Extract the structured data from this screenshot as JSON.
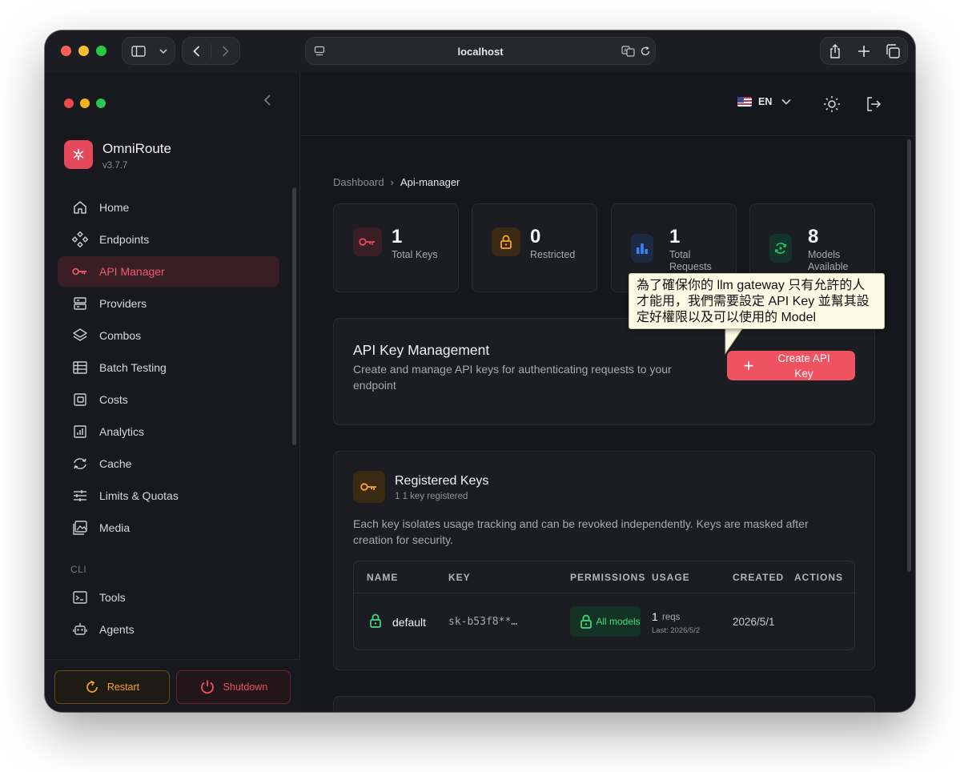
{
  "browser": {
    "url": "localhost"
  },
  "app": {
    "name": "OmniRoute",
    "version": "v3.7.7"
  },
  "sidebar": {
    "items": [
      {
        "label": "Home",
        "icon": "home-icon"
      },
      {
        "label": "Endpoints",
        "icon": "endpoints-icon"
      },
      {
        "label": "API Manager",
        "icon": "key-icon",
        "active": true
      },
      {
        "label": "Providers",
        "icon": "server-icon"
      },
      {
        "label": "Combos",
        "icon": "layers-icon"
      },
      {
        "label": "Batch Testing",
        "icon": "table-icon"
      },
      {
        "label": "Costs",
        "icon": "wallet-icon"
      },
      {
        "label": "Analytics",
        "icon": "chart-icon"
      },
      {
        "label": "Cache",
        "icon": "refresh-icon"
      },
      {
        "label": "Limits & Quotas",
        "icon": "sliders-icon"
      },
      {
        "label": "Media",
        "icon": "media-icon"
      }
    ],
    "section_cli": "CLI",
    "cli_items": [
      {
        "label": "Tools",
        "icon": "terminal-icon"
      },
      {
        "label": "Agents",
        "icon": "robot-icon"
      }
    ],
    "restart_label": "Restart",
    "shutdown_label": "Shutdown"
  },
  "header": {
    "language": "EN"
  },
  "breadcrumb": {
    "root": "Dashboard",
    "separator": "›",
    "current": "Api-manager"
  },
  "stats": [
    {
      "value": "1",
      "label": "Total Keys",
      "icon": "key-icon",
      "color": "#e5485a"
    },
    {
      "value": "0",
      "label": "Restricted",
      "icon": "lock-icon",
      "color": "#f5a524"
    },
    {
      "value": "1",
      "label": "Total Requests",
      "icon": "bar-chart-icon",
      "color": "#3b82f6"
    },
    {
      "value": "8",
      "label": "Models Available",
      "icon": "cycle-icon",
      "color": "#22c55e"
    }
  ],
  "management": {
    "title": "API Key Management",
    "subtitle": "Create and manage API keys for authenticating requests to your endpoint",
    "create_label": "Create API Key"
  },
  "registered": {
    "title": "Registered Keys",
    "subtitle": "1 1 key registered",
    "description": "Each key isolates usage tracking and can be revoked independently. Keys are masked after creation for security.",
    "columns": [
      "NAME",
      "KEY",
      "PERMISSIONS",
      "USAGE",
      "CREATED",
      "ACTIONS"
    ],
    "rows": [
      {
        "name": "default",
        "key": "sk-b53f8**…",
        "permissions": "All models",
        "usage_count": "1",
        "usage_unit": "reqs",
        "usage_last": "Last: 2026/5/2",
        "created": "2026/5/1"
      }
    ]
  },
  "annotation": {
    "text": "為了確保你的 llm gateway 只有允許的人才能用，我們需要設定 API Key 並幫其設定好權限以及可以使用的 Model"
  },
  "colors": {
    "accent": "#ef5261",
    "background": "#15171c",
    "card": "#1b1d23"
  }
}
